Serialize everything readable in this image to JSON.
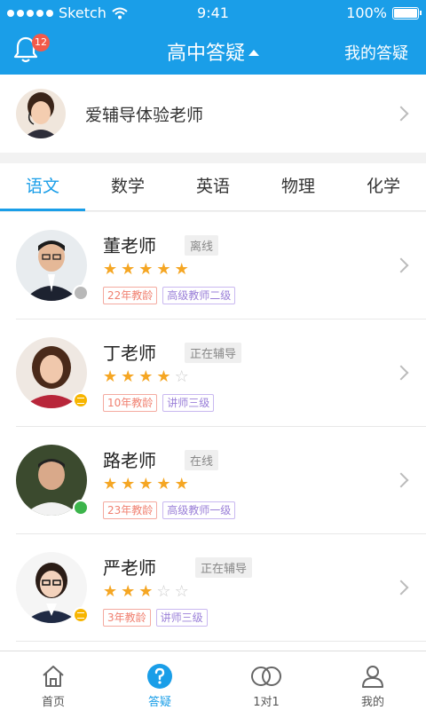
{
  "statusbar": {
    "carrier": "Sketch",
    "time": "9:41",
    "battery": "100%"
  },
  "navbar": {
    "badge": "12",
    "title": "高中答疑",
    "right_link": "我的答疑"
  },
  "profile": {
    "name": "爱辅导体验老师"
  },
  "tabs": [
    {
      "label": "语文",
      "active": true
    },
    {
      "label": "数学"
    },
    {
      "label": "英语"
    },
    {
      "label": "物理"
    },
    {
      "label": "化学"
    }
  ],
  "teachers": [
    {
      "name": "董老师",
      "status": "离线",
      "rating": 5,
      "years": "22年教龄",
      "rank": "高级教师二级",
      "presence": "offline"
    },
    {
      "name": "丁老师",
      "status": "正在辅导",
      "rating": 4,
      "years": "10年教龄",
      "rank": "讲师三级",
      "presence": "busy"
    },
    {
      "name": "路老师",
      "status": "在线",
      "rating": 5,
      "years": "23年教龄",
      "rank": "高级教师一级",
      "presence": "online"
    },
    {
      "name": "严老师",
      "status": "正在辅导",
      "rating": 3,
      "years": "3年教龄",
      "rank": "讲师三级",
      "presence": "busy"
    }
  ],
  "tabbar": [
    {
      "label": "首页",
      "icon": "home-icon"
    },
    {
      "label": "答疑",
      "icon": "question-icon",
      "active": true
    },
    {
      "label": "1对1",
      "icon": "rings-icon"
    },
    {
      "label": "我的",
      "icon": "user-icon"
    }
  ],
  "colors": {
    "primary": "#1a9ee8",
    "star": "#f5a623",
    "badge": "#f25a4a"
  }
}
